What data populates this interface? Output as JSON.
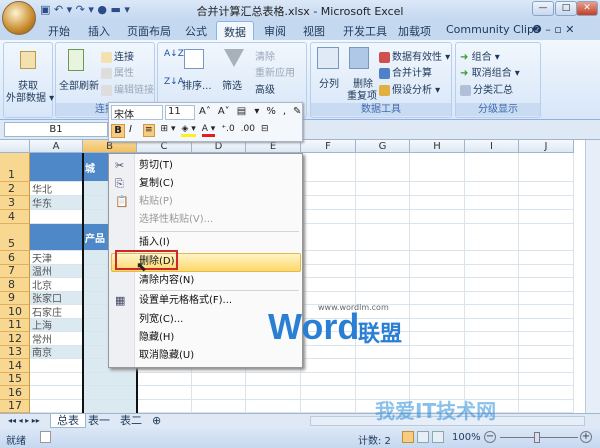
{
  "window": {
    "title": "合并计算汇总表格.xlsx - Microsoft Excel",
    "qat": "▣ ↶ ▾ ↷ ▾ ● ▬ ▾",
    "min": "—",
    "max": "□",
    "close": "✕"
  },
  "tabs": [
    "开始",
    "插入",
    "页面布局",
    "公式",
    "数据",
    "审阅",
    "视图",
    "开发工具",
    "加载项",
    "Community Clips"
  ],
  "tab_right": "❷ – ▫ ✕",
  "ribbon": {
    "get_data": {
      "label1": "获取",
      "label2": "外部数据 ▾"
    },
    "refresh": {
      "all": "全部刷新",
      "connect": "连接",
      "props": "属性",
      "edit_links": "编辑链接",
      "group": "连接"
    },
    "sort": {
      "az": "A↓Z",
      "za": "Z↓A",
      "sort": "排序...",
      "filter": "筛选",
      "clear": "清除",
      "reapply": "重新应用",
      "advanced": "高级"
    },
    "tools": {
      "split": "分列",
      "dedupe1": "删除",
      "dedupe2": "重复项",
      "validation": "数据有效性 ▾",
      "consolidate": "合并计算",
      "whatif": "假设分析 ▾",
      "group": "数据工具"
    },
    "outline": {
      "group_btn": "组合 ▾",
      "ungroup": "取消组合 ▾",
      "subtotal": "分类汇总",
      "group": "分级显示"
    }
  },
  "namebox": "B1",
  "mini_toolbar": {
    "font": "宋体",
    "size": "11",
    "row1": [
      "A˄",
      "A˅",
      "▤ ▾",
      "%",
      ",",
      "✎"
    ],
    "bold": "B",
    "italic": "I",
    "row2": [
      "≡",
      "⊞ ▾",
      "◈ ▾",
      "A ▾",
      "⁺.0",
      ".00",
      "⊟"
    ]
  },
  "columns": [
    "A",
    "B",
    "C",
    "D",
    "E",
    "F",
    "G",
    "H",
    "I",
    "J"
  ],
  "rows": [
    "1",
    "2",
    "3",
    "4",
    "5",
    "6",
    "7",
    "8",
    "9",
    "10",
    "11",
    "12",
    "13",
    "14",
    "15",
    "16",
    "17"
  ],
  "col_a": [
    "",
    "华北",
    "华东",
    "",
    "",
    "天津",
    "温州",
    "北京",
    "张家口",
    "石家庄",
    "上海",
    "常州",
    "南京",
    "",
    "",
    "",
    ""
  ],
  "b_headers": {
    "b1": "城",
    "b5": "产品"
  },
  "context_menu": [
    {
      "label": "剪切(T)",
      "icon": "✂",
      "enabled": true
    },
    {
      "label": "复制(C)",
      "icon": "⎘",
      "enabled": true
    },
    {
      "label": "粘贴(P)",
      "icon": "📋",
      "enabled": false
    },
    {
      "label": "选择性粘贴(V)...",
      "icon": "",
      "enabled": false
    },
    {
      "label": "插入(I)",
      "icon": "",
      "enabled": true
    },
    {
      "label": "删除(D)",
      "icon": "",
      "enabled": true,
      "highlighted": true
    },
    {
      "label": "清除内容(N)",
      "icon": "",
      "enabled": true
    },
    {
      "label": "设置单元格格式(F)...",
      "icon": "▦",
      "enabled": true
    },
    {
      "label": "列宽(C)...",
      "icon": "",
      "enabled": true
    },
    {
      "label": "隐藏(H)",
      "icon": "",
      "enabled": true
    },
    {
      "label": "取消隐藏(U)",
      "icon": "",
      "enabled": true
    }
  ],
  "sheets": {
    "nav": "◂◂ ◂ ▸ ▸▸",
    "tabs": [
      "总表",
      "表一",
      "表二"
    ],
    "new": "⊕"
  },
  "status": {
    "ready": "就绪",
    "count": "计数: 2",
    "zoom": "100%",
    "minus": "−",
    "plus": "+"
  },
  "watermarks": {
    "word": "Word",
    "lm": "联盟",
    "url": "www.wordlm.com",
    "it": "我爱IT技术网"
  },
  "colors": {
    "accent": "#4f88c8",
    "highlight": "#fcd96a",
    "red": "#d0262a"
  }
}
